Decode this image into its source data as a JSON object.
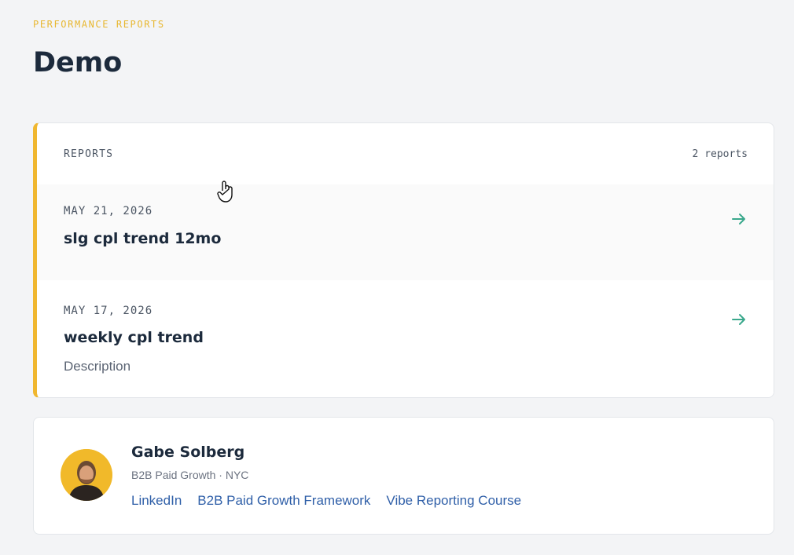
{
  "header": {
    "eyebrow": "PERFORMANCE REPORTS",
    "title": "Demo"
  },
  "reports": {
    "label": "REPORTS",
    "count": "2 reports",
    "items": [
      {
        "date": "MAY 21, 2026",
        "title": "slg cpl trend 12mo",
        "description": ""
      },
      {
        "date": "MAY 17, 2026",
        "title": "weekly cpl trend",
        "description": "Description"
      }
    ]
  },
  "author": {
    "name": "Gabe Solberg",
    "meta": "B2B Paid Growth · NYC",
    "links": [
      "LinkedIn",
      "B2B Paid Growth Framework",
      "Vibe Reporting Course"
    ]
  },
  "icons": {
    "row_arrow": "arrow-right-icon",
    "cursor": "hand-pointer-icon"
  },
  "colors": {
    "accent": "#f0b72f",
    "eyebrow": "#e8b730",
    "arrow": "#3aa88c",
    "link": "#2f5fa8",
    "heading": "#1c2a3c"
  }
}
